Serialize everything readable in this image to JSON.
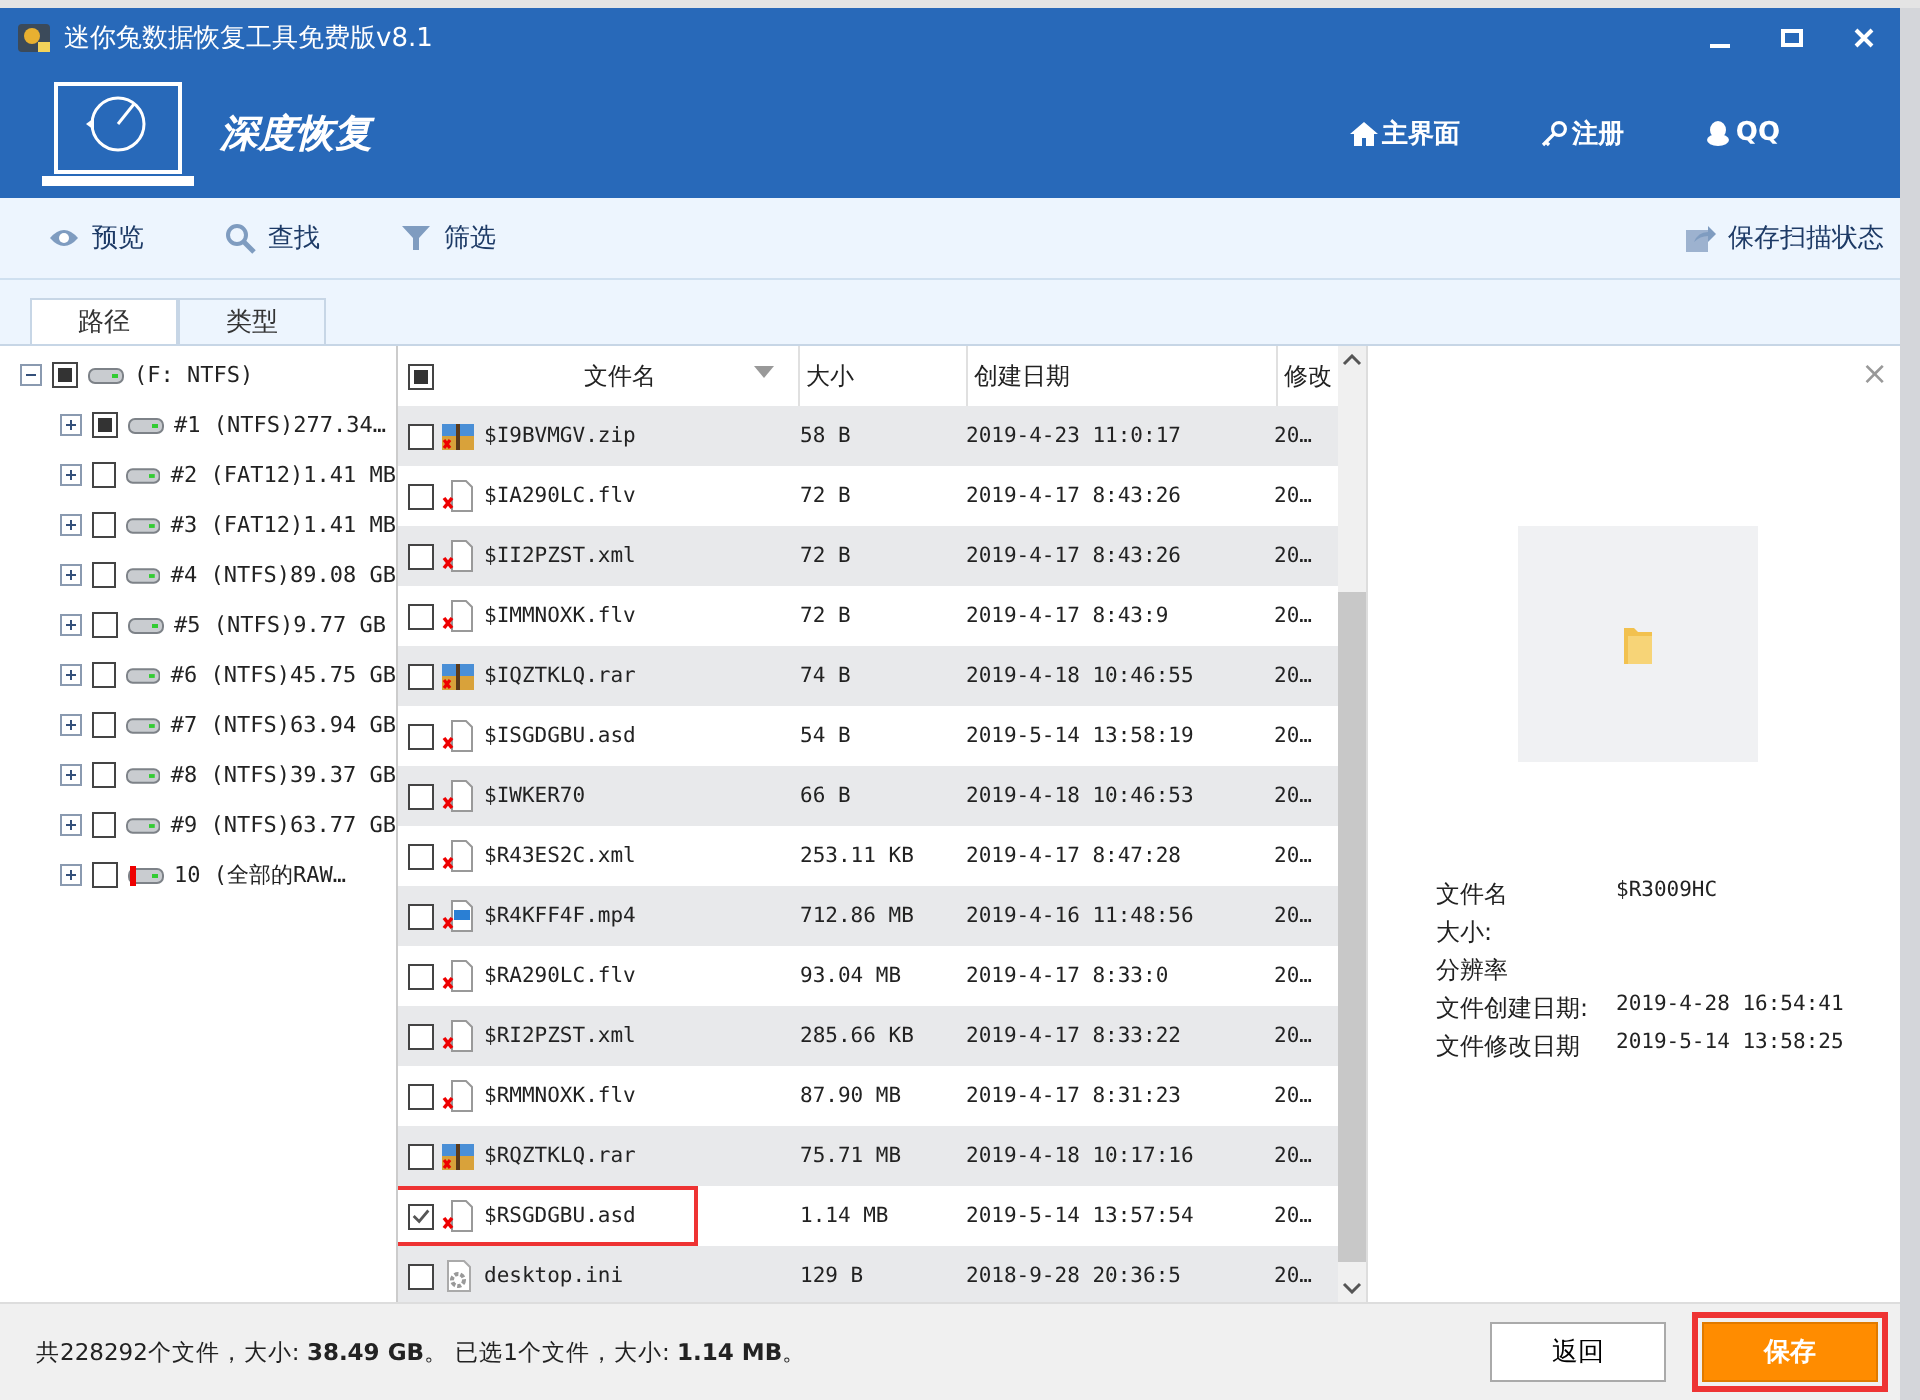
{
  "window": {
    "title": "迷你兔数据恢复工具免费版v8.1"
  },
  "header": {
    "mode_title": "深度恢复",
    "nav": [
      {
        "kind": "home",
        "label": "主界面"
      },
      {
        "kind": "key",
        "label": "注册"
      },
      {
        "kind": "qq",
        "label": "QQ"
      }
    ]
  },
  "toolbar": {
    "left": [
      {
        "kind": "eye",
        "label": "预览"
      },
      {
        "kind": "search",
        "label": "查找"
      },
      {
        "kind": "filter",
        "label": "筛选"
      }
    ],
    "right": {
      "label": "保存扫描状态"
    }
  },
  "tabs": [
    {
      "label": "路径",
      "selected": true
    },
    {
      "label": "类型",
      "selected": false
    }
  ],
  "tree": {
    "label": "(F: NTFS)",
    "partial": true,
    "expanded": true,
    "kind": "drive",
    "children": [
      {
        "label": "#1 (NTFS)277.34…",
        "partial": true,
        "expanded": false,
        "kind": "drive"
      },
      {
        "label": "#2 (FAT12)1.41 MB",
        "partial": false,
        "expanded": false,
        "kind": "drive"
      },
      {
        "label": "#3 (FAT12)1.41 MB",
        "partial": false,
        "expanded": false,
        "kind": "drive"
      },
      {
        "label": "#4 (NTFS)89.08 GB",
        "partial": false,
        "expanded": false,
        "kind": "drive"
      },
      {
        "label": "#5 (NTFS)9.77 GB",
        "partial": false,
        "expanded": false,
        "kind": "drive"
      },
      {
        "label": "#6 (NTFS)45.75 GB",
        "partial": false,
        "expanded": false,
        "kind": "drive"
      },
      {
        "label": "#7 (NTFS)63.94 GB",
        "partial": false,
        "expanded": false,
        "kind": "drive"
      },
      {
        "label": "#8 (NTFS)39.37 GB",
        "partial": false,
        "expanded": false,
        "kind": "drive"
      },
      {
        "label": "#9 (NTFS)63.77 GB",
        "partial": false,
        "expanded": false,
        "kind": "drive"
      },
      {
        "label": "10 (全部的RAW…",
        "partial": false,
        "expanded": false,
        "kind": "raw"
      }
    ]
  },
  "table": {
    "select_all_partial": true,
    "columns": [
      "文件名",
      "大小",
      "创建日期",
      "修改"
    ],
    "rows": [
      {
        "kind": "archive",
        "name": "$I9BVMGV.zip",
        "size": "58 B",
        "created": "2019-4-23 11:0:17",
        "modified": "20…",
        "checked": false,
        "highlighted": false
      },
      {
        "kind": "deleted",
        "name": "$IA290LC.flv",
        "size": "72 B",
        "created": "2019-4-17 8:43:26",
        "modified": "20…",
        "checked": false,
        "highlighted": false
      },
      {
        "kind": "deleted",
        "name": "$II2PZST.xml",
        "size": "72 B",
        "created": "2019-4-17 8:43:26",
        "modified": "20…",
        "checked": false,
        "highlighted": false
      },
      {
        "kind": "deleted",
        "name": "$IMMNOXK.flv",
        "size": "72 B",
        "created": "2019-4-17 8:43:9",
        "modified": "20…",
        "checked": false,
        "highlighted": false
      },
      {
        "kind": "archive",
        "name": "$IQZTKLQ.rar",
        "size": "74 B",
        "created": "2019-4-18 10:46:55",
        "modified": "20…",
        "checked": false,
        "highlighted": false
      },
      {
        "kind": "deleted",
        "name": "$ISGDGBU.asd",
        "size": "54 B",
        "created": "2019-5-14 13:58:19",
        "modified": "20…",
        "checked": false,
        "highlighted": false
      },
      {
        "kind": "deleted",
        "name": "$IWKER70",
        "size": "66 B",
        "created": "2019-4-18 10:46:53",
        "modified": "20…",
        "checked": false,
        "highlighted": false
      },
      {
        "kind": "deleted",
        "name": "$R43ES2C.xml",
        "size": "253.11 KB",
        "created": "2019-4-17 8:47:28",
        "modified": "20…",
        "checked": false,
        "highlighted": false
      },
      {
        "kind": "video",
        "name": "$R4KFF4F.mp4",
        "size": "712.86 MB",
        "created": "2019-4-16 11:48:56",
        "modified": "20…",
        "checked": false,
        "highlighted": false
      },
      {
        "kind": "deleted",
        "name": "$RA290LC.flv",
        "size": "93.04 MB",
        "created": "2019-4-17 8:33:0",
        "modified": "20…",
        "checked": false,
        "highlighted": false
      },
      {
        "kind": "deleted",
        "name": "$RI2PZST.xml",
        "size": "285.66 KB",
        "created": "2019-4-17 8:33:22",
        "modified": "20…",
        "checked": false,
        "highlighted": false
      },
      {
        "kind": "deleted",
        "name": "$RMMNOXK.flv",
        "size": "87.90 MB",
        "created": "2019-4-17 8:31:23",
        "modified": "20…",
        "checked": false,
        "highlighted": false
      },
      {
        "kind": "archive",
        "name": "$RQZTKLQ.rar",
        "size": "75.71 MB",
        "created": "2019-4-18 10:17:16",
        "modified": "20…",
        "checked": false,
        "highlighted": false
      },
      {
        "kind": "deleted",
        "name": "$RSGDGBU.asd",
        "size": "1.14 MB",
        "created": "2019-5-14 13:57:54",
        "modified": "20…",
        "checked": true,
        "highlighted": true
      },
      {
        "kind": "settings",
        "name": "desktop.ini",
        "size": "129 B",
        "created": "2018-9-28 20:36:5",
        "modified": "20…",
        "checked": false,
        "highlighted": false
      }
    ]
  },
  "preview": {
    "close": "×",
    "info": [
      {
        "label": "文件名",
        "value": "$R3009HC"
      },
      {
        "label": "大小:"
      },
      {
        "label": "分辨率"
      },
      {
        "label": "文件创建日期:",
        "value": "2019-4-28 16:54:41"
      },
      {
        "label": "文件修改日期",
        "value": "2019-5-14 13:58:25"
      }
    ]
  },
  "status_bar": {
    "summary": "共228292个文件，大小: **38.49 GB**。 已选1个文件，大小: **1.14 MB**。"
  },
  "buttons": [
    {
      "kind": "secondary",
      "label": "返回",
      "highlighted": false
    },
    {
      "kind": "primary",
      "label": "保存",
      "highlighted": true
    }
  ]
}
